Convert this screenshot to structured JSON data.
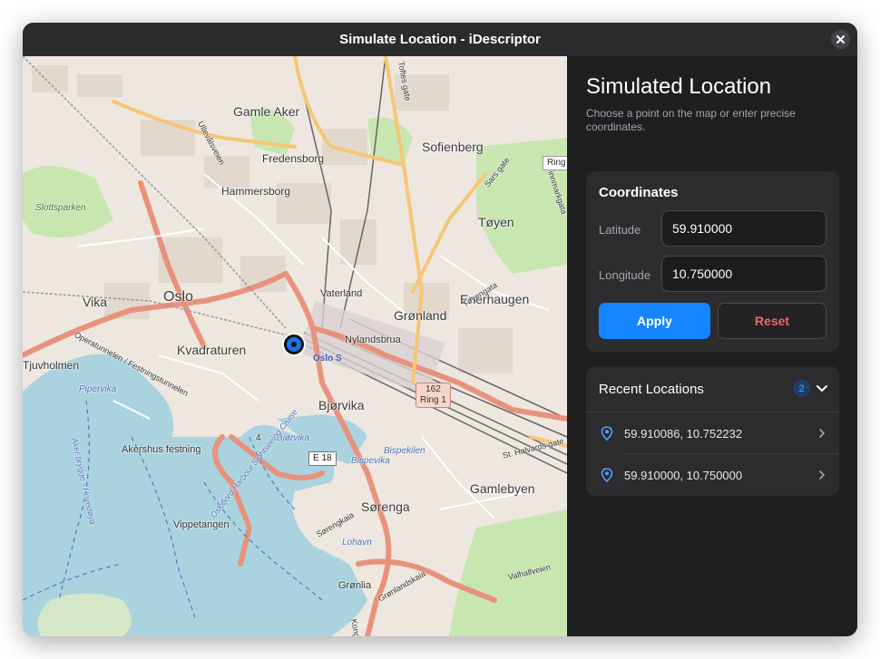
{
  "window": {
    "title": "Simulate Location - iDescriptor"
  },
  "map": {
    "districts": [
      "Gamle Aker",
      "Fredensborg",
      "Hammersborg",
      "Sofienberg",
      "Tøyen",
      "Oslo",
      "Vika",
      "Vaterland",
      "Grønland",
      "Enerhaugen",
      "Kvadraturen",
      "Nylandsbrua",
      "Bjørvika",
      "Akershus festning",
      "Gamlebyen",
      "Vippetangen",
      "Sørenga",
      "Grønlia",
      "Tjuvholmen"
    ],
    "water": [
      "Pipervika",
      "Bjørvika",
      "Bispevika",
      "Bispekilen",
      "Lohavn",
      "Oslofjord Harbour Sightseeing Cruise",
      "Aker brygge - Hovedøya"
    ],
    "parks": [
      "Slottsparken"
    ],
    "stations": [
      "Oslo S"
    ],
    "roads": [
      "Operatunnelen / Festningstunnelen",
      "Sars gate",
      "Tøyengata",
      "St. Halvards gate",
      "Sørengkaia",
      "Grønlandskaia",
      "Kongsveien",
      "Valhallveien",
      "Toftes gate",
      "Ullevålsveien",
      "Finnmarkgata"
    ],
    "shields": {
      "ring_number": "162",
      "ring_name": "Ring 1",
      "e18": "E 18",
      "ring_top": "Ring",
      "four": "4"
    },
    "marker": {
      "latitude": 59.91,
      "longitude": 10.75
    }
  },
  "panel": {
    "title": "Simulated Location",
    "subtitle": "Choose a point on the map or enter precise coordinates.",
    "coordinates": {
      "heading": "Coordinates",
      "latitude_label": "Latitude",
      "latitude_value": "59.910000",
      "longitude_label": "Longitude",
      "longitude_value": "10.750000",
      "apply_label": "Apply",
      "reset_label": "Reset"
    },
    "recent": {
      "title": "Recent Locations",
      "count": "2",
      "items": [
        {
          "label": "59.910086, 10.752232"
        },
        {
          "label": "59.910000, 10.750000"
        }
      ]
    }
  },
  "colors": {
    "accent": "#1485ff",
    "reset": "#f06565",
    "water": "#aad3df",
    "park": "#c8e6b0",
    "major_road": "#e8927c"
  },
  "icons": [
    "close-icon",
    "location-marker-icon",
    "chevron-down-icon",
    "map-pin-icon",
    "chevron-right-icon"
  ]
}
